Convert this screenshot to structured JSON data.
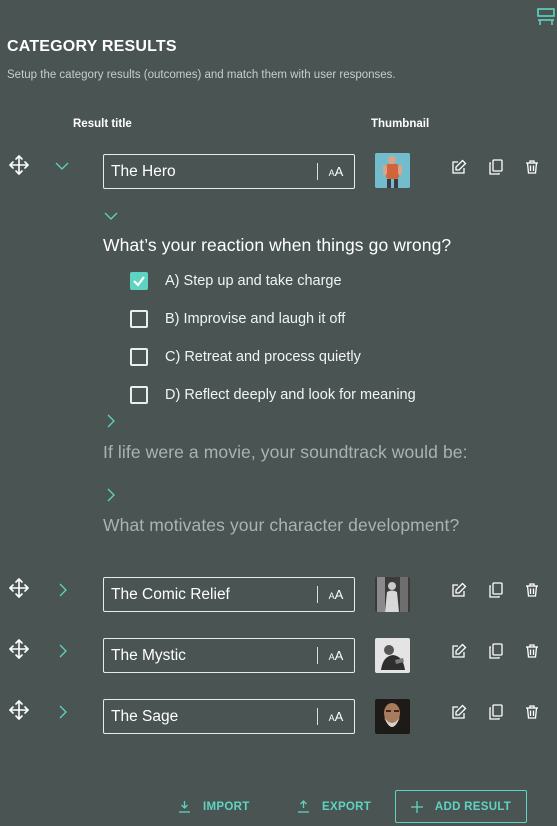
{
  "header": {
    "title": "CATEGORY RESULTS",
    "subtitle": "Setup the category results (outcomes) and match them with user responses."
  },
  "columns": {
    "result_title": "Result title",
    "thumbnail": "Thumbnail"
  },
  "results": [
    {
      "title": "The Hero",
      "expanded": true
    },
    {
      "title": "The Comic Relief",
      "expanded": false
    },
    {
      "title": "The Mystic",
      "expanded": false
    },
    {
      "title": "The Sage",
      "expanded": false
    }
  ],
  "font_toggle": {
    "small": "A",
    "large": "A"
  },
  "questions": [
    {
      "text": "What’s your reaction when things go wrong?",
      "expanded": true,
      "options": [
        {
          "label": "A) Step up and take charge",
          "checked": true
        },
        {
          "label": "B) Improvise and laugh it off",
          "checked": false
        },
        {
          "label": "C) Retreat and process quietly",
          "checked": false
        },
        {
          "label": "D) Reflect deeply and look for meaning",
          "checked": false
        }
      ]
    },
    {
      "text": "If life were a movie, your soundtrack would be:",
      "expanded": false
    },
    {
      "text": "What motivates your character development?",
      "expanded": false
    }
  ],
  "footer": {
    "import_label": "IMPORT",
    "export_label": "EXPORT",
    "add_label": "ADD RESULT"
  },
  "colors": {
    "background": "#4a5553",
    "accent": "#5fd3c1",
    "text": "#ffffff",
    "muted": "#aab3b1"
  }
}
